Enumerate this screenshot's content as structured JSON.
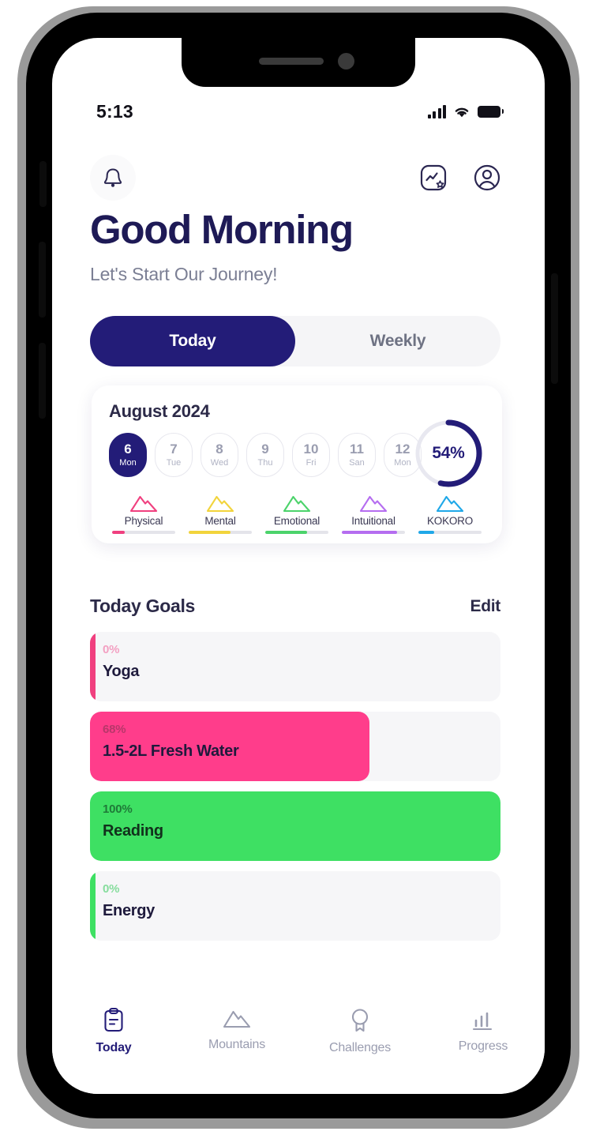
{
  "status_bar": {
    "time": "5:13",
    "signal_icon": "signal-bars-icon",
    "wifi_icon": "wifi-icon",
    "battery_icon": "battery-icon"
  },
  "topbar": {
    "bell_icon": "bell-icon",
    "stats_icon": "stats-star-icon",
    "profile_icon": "profile-avatar-icon"
  },
  "greeting": {
    "title": "Good Morning",
    "subtitle": "Let's Start Our Journey!"
  },
  "tabs": [
    {
      "label": "Today",
      "active": true
    },
    {
      "label": "Weekly",
      "active": false
    }
  ],
  "calendar": {
    "month": "August 2024",
    "days": [
      {
        "num": "6",
        "label": "Mon",
        "selected": true
      },
      {
        "num": "7",
        "label": "Tue",
        "selected": false
      },
      {
        "num": "8",
        "label": "Wed",
        "selected": false
      },
      {
        "num": "9",
        "label": "Thu",
        "selected": false
      },
      {
        "num": "10",
        "label": "Fri",
        "selected": false
      },
      {
        "num": "11",
        "label": "San",
        "selected": false
      },
      {
        "num": "12",
        "label": "Mon",
        "selected": false
      }
    ],
    "progress_ring": {
      "value": 54,
      "label": "54%",
      "color": "#231c78",
      "track_color": "#e8e8f0"
    }
  },
  "mountains": [
    {
      "label": "Physical",
      "color": "#f0407f",
      "progress": 20
    },
    {
      "label": "Mental",
      "color": "#f2d43c",
      "progress": 66
    },
    {
      "label": "Emotional",
      "color": "#4cd36b",
      "progress": 66
    },
    {
      "label": "Intuitional",
      "color": "#b56df0",
      "progress": 88
    },
    {
      "label": "KOKORO",
      "color": "#20a8e8",
      "progress": 25
    }
  ],
  "goals_section": {
    "title": "Today Goals",
    "edit_label": "Edit"
  },
  "goals": [
    {
      "name": "Yoga",
      "percent_label": "0%",
      "percent": 2,
      "color": "#f0407f",
      "pct_text_color": "#f3a0c2"
    },
    {
      "name": "1.5-2L Fresh Water",
      "percent_label": "68%",
      "percent": 68,
      "color": "#ff3d8b",
      "pct_text_color": "#b8376a"
    },
    {
      "name": "Reading",
      "percent_label": "100%",
      "percent": 100,
      "color": "#3ee063",
      "pct_text_color": "#1f7a38"
    },
    {
      "name": "Energy",
      "percent_label": "0%",
      "percent": 1.6,
      "color": "#3ee063",
      "pct_text_color": "#86dd9d"
    }
  ],
  "bottom_nav": [
    {
      "label": "Today",
      "icon": "clipboard-icon",
      "active": true
    },
    {
      "label": "Mountains",
      "icon": "mountain-icon",
      "active": false
    },
    {
      "label": "Challenges",
      "icon": "medal-icon",
      "active": false
    },
    {
      "label": "Progress",
      "icon": "bar-chart-icon",
      "active": false
    }
  ],
  "theme": {
    "primary": "#231c78",
    "text_dark": "#1e1a56",
    "text_muted": "#7b7f94",
    "card_bg": "#f6f6f8"
  }
}
